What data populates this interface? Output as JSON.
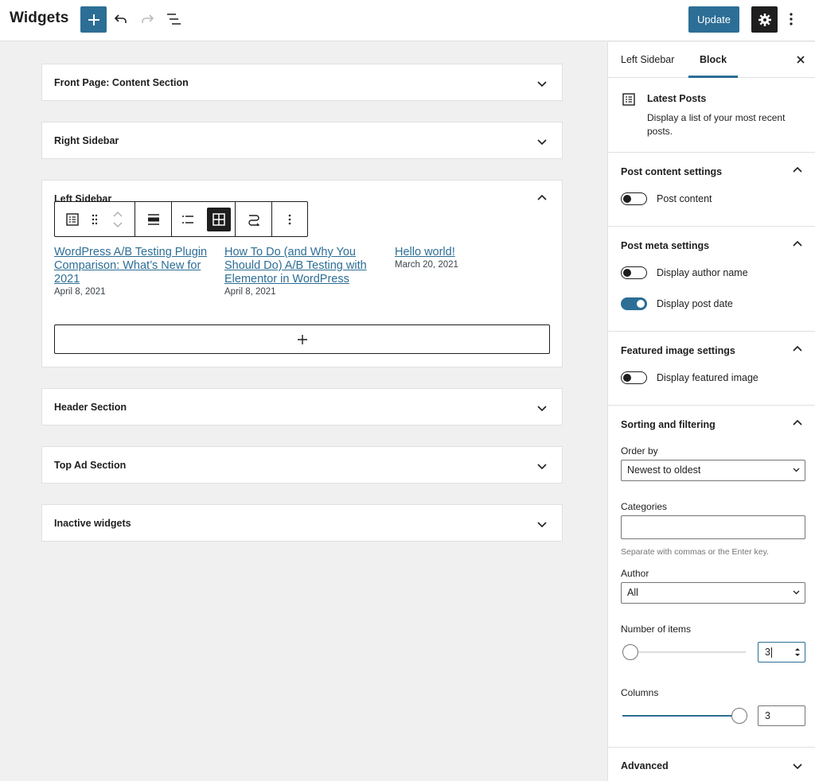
{
  "header": {
    "title": "Widgets",
    "update_label": "Update"
  },
  "areas": [
    {
      "title": "Front Page: Content Section",
      "expanded": false
    },
    {
      "title": "Right Sidebar",
      "expanded": false
    },
    {
      "title": "Left Sidebar",
      "expanded": true
    },
    {
      "title": "Header Section",
      "expanded": false
    },
    {
      "title": "Top Ad Section",
      "expanded": false
    },
    {
      "title": "Inactive widgets",
      "expanded": false
    }
  ],
  "posts": [
    {
      "title": "WordPress A/B Testing Plugin Comparison: What’s New for 2021",
      "date": "April 8, 2021"
    },
    {
      "title": "How To Do (and Why You Should Do) A/B Testing with Elementor in WordPress",
      "date": "April 8, 2021"
    },
    {
      "title": "Hello world!",
      "date": "March 20, 2021"
    }
  ],
  "sidebar": {
    "tabs": [
      "Left Sidebar",
      "Block"
    ],
    "active_tab": "Block",
    "block": {
      "name": "Latest Posts",
      "description": "Display a list of your most recent posts."
    },
    "post_content": {
      "title": "Post content settings",
      "toggle_label": "Post content",
      "toggle_on": false
    },
    "post_meta": {
      "title": "Post meta settings",
      "author_label": "Display author name",
      "author_on": false,
      "date_label": "Display post date",
      "date_on": true
    },
    "featured": {
      "title": "Featured image settings",
      "toggle_label": "Display featured image",
      "toggle_on": false
    },
    "sorting": {
      "title": "Sorting and filtering",
      "order_label": "Order by",
      "order_value": "Newest to oldest",
      "categories_label": "Categories",
      "categories_value": "",
      "categories_help": "Separate with commas or the Enter key.",
      "author_label": "Author",
      "author_value": "All",
      "items_label": "Number of items",
      "items_value": "3",
      "columns_label": "Columns",
      "columns_value": "3"
    },
    "advanced": {
      "title": "Advanced"
    }
  },
  "colors": {
    "accent": "#2c6e95",
    "dark": "#1e1e1e",
    "canvas": "#f0f0f0"
  }
}
